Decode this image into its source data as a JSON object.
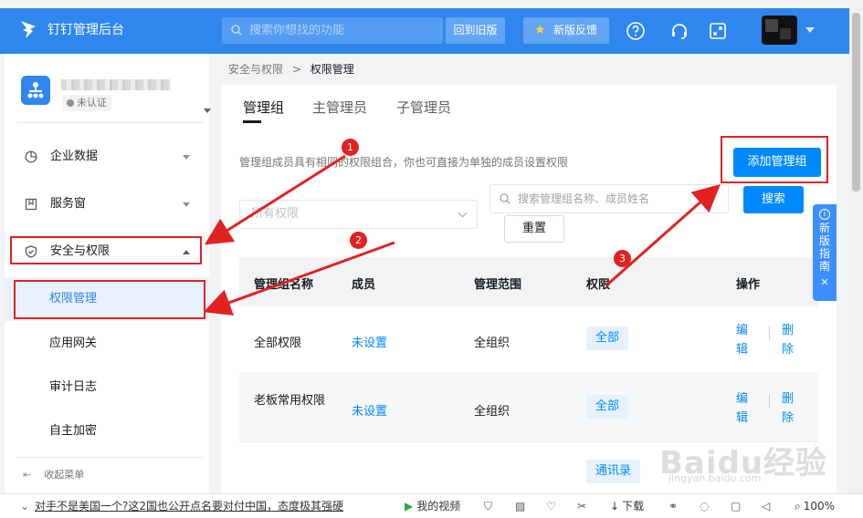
{
  "header": {
    "app_name": "钉钉管理后台",
    "search_placeholder": "搜索你想找的功能",
    "old_version_label": "回到旧版",
    "feedback_label": "新版反馈"
  },
  "org": {
    "status": "未认证"
  },
  "sidebar": {
    "items": [
      {
        "label": "企业数据",
        "icon": "pie-chart-icon"
      },
      {
        "label": "服务窗",
        "icon": "bookmark-icon"
      },
      {
        "label": "安全与权限",
        "icon": "shield-icon"
      }
    ],
    "sub_items": [
      "权限管理",
      "应用网关",
      "审计日志",
      "自主加密"
    ],
    "collapse_label": "收起菜单"
  },
  "breadcrumb": {
    "parent": "安全与权限",
    "current": "权限管理"
  },
  "tabs": [
    "管理组",
    "主管理员",
    "子管理员"
  ],
  "description": "管理组成员具有相同的权限组合，你也可直接为单独的成员设置权限",
  "buttons": {
    "add_group": "添加管理组",
    "search": "搜索",
    "reset": "重置"
  },
  "filters": {
    "permission_placeholder": "所有权限",
    "search_placeholder": "搜索管理组名称、成员姓名"
  },
  "table": {
    "columns": [
      "管理组名称",
      "成员",
      "管理范围",
      "权限",
      "操作"
    ],
    "rows": [
      {
        "name": "全部权限",
        "members": "未设置",
        "scope": "全组织",
        "permission": "全部",
        "edit": "编辑",
        "delete": "删除"
      },
      {
        "name": "老板常用权限",
        "members": "未设置",
        "scope": "全组织",
        "permission": "全部",
        "edit": "编辑",
        "delete": "删除"
      },
      {
        "name": "",
        "members": "",
        "scope": "",
        "permission": "通讯录",
        "edit": "",
        "delete": ""
      }
    ]
  },
  "guide": {
    "label": "新版指南"
  },
  "annotations": [
    "1",
    "2",
    "3"
  ],
  "statusbar": {
    "news": "对手不是美国一个?这2国也公开点名要对付中国，态度极其强硬",
    "video": "我的视频",
    "download": "下载",
    "zoom": "100%"
  },
  "watermark": {
    "brand": "Baidu经验",
    "url": "jingyan.baidu.com"
  },
  "colors": {
    "header_bg": "#2f87ee",
    "primary": "#0089ff",
    "annotation_red": "#e12222",
    "active_bg": "#e8f2fd"
  }
}
